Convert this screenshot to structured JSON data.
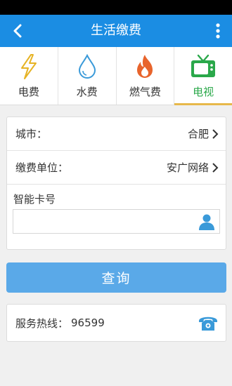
{
  "header": {
    "title": "生活缴费",
    "back_icon": "back-arrow-icon",
    "more_icon": "more-vertical-icon"
  },
  "tabs": [
    {
      "label": "电费",
      "icon": "lightning-icon",
      "active": false
    },
    {
      "label": "水费",
      "icon": "water-drop-icon",
      "active": false
    },
    {
      "label": "燃气费",
      "icon": "flame-icon",
      "active": false
    },
    {
      "label": "电视",
      "icon": "tv-icon",
      "active": true
    }
  ],
  "form": {
    "city_label": "城市：",
    "city_value": "合肥",
    "unit_label": "缴费单位：",
    "unit_value": "安广网络",
    "card_label": "智能卡号",
    "card_value": "",
    "card_placeholder": ""
  },
  "query_button": "查询",
  "hotline": {
    "label": "服务热线：",
    "number": "96599"
  },
  "colors": {
    "nav": "#1b8de3",
    "active_tab_text": "#2aa84a",
    "active_tab_underline": "#e7b84a",
    "button": "#5aa9e8",
    "icon_blue": "#3a9ad9"
  }
}
